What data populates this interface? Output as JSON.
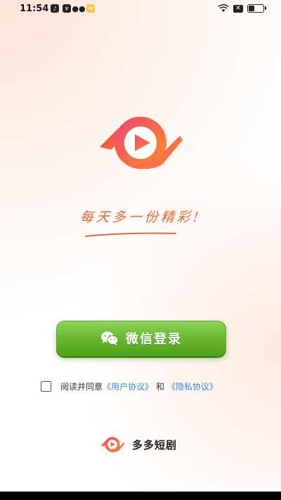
{
  "status_bar": {
    "time": "11:54",
    "left_icons": [
      "tiktok-icon",
      "capcut-icon",
      "wechat-icon",
      "mail-icon"
    ],
    "right_icons": [
      "wifi-icon",
      "sim-icon",
      "battery-icon"
    ]
  },
  "slogan": "每天多一份精彩!",
  "login": {
    "wechat_label": "微信登录"
  },
  "agreement": {
    "prefix": "阅读并同意",
    "user_agreement": "《用户协议》",
    "and": "和",
    "privacy_policy": "《隐私协议》"
  },
  "brand": {
    "name": "多多短剧"
  },
  "colors": {
    "accent_orange": "#e26a32",
    "logo_gradient_start": "#f04a6e",
    "logo_gradient_end": "#ff8a2a",
    "button_green": "#6cbb34",
    "link_blue": "#2e8be0"
  }
}
